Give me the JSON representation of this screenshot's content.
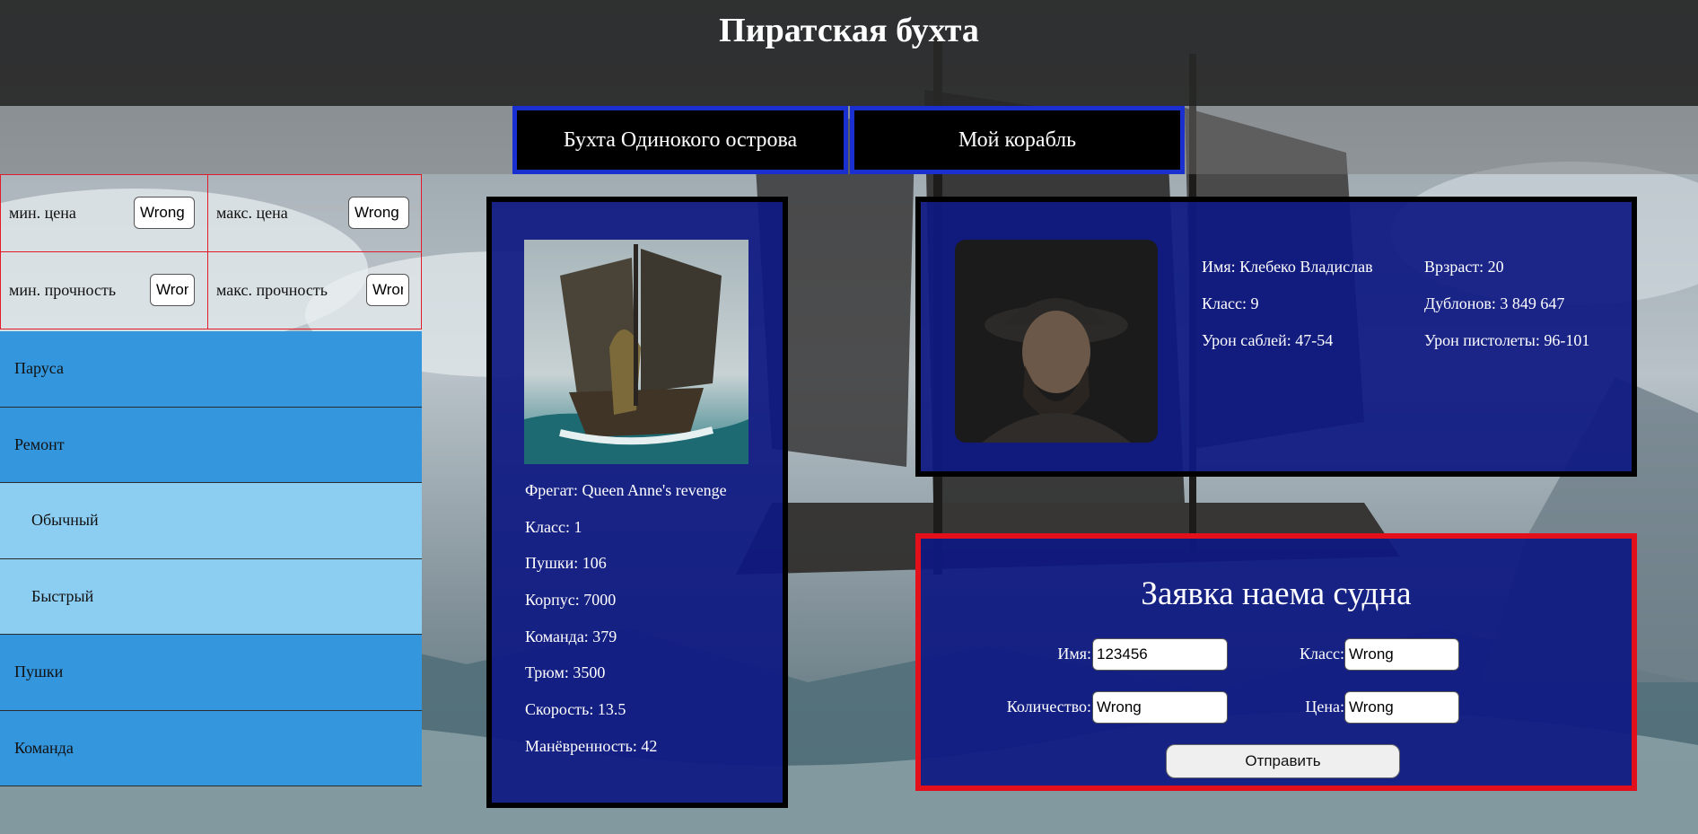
{
  "header": {
    "title": "Пиратская бухта"
  },
  "nav": {
    "tabs": [
      {
        "label": "Бухта Одинокого острова"
      },
      {
        "label": "Мой корабль"
      }
    ]
  },
  "filters": {
    "min_price": {
      "label": "мин. цена",
      "value": "Wrong"
    },
    "max_price": {
      "label": "макс. цена",
      "value": "Wrong"
    },
    "min_durability": {
      "label": "мин. прочность",
      "value": "Wrong"
    },
    "max_durability": {
      "label": "макс. прочность",
      "value": "Wrong"
    }
  },
  "menu": {
    "items": [
      {
        "label": "Паруса"
      },
      {
        "label": "Ремонт"
      },
      {
        "label": "Обычный"
      },
      {
        "label": "Быстрый"
      },
      {
        "label": "Пушки"
      },
      {
        "label": "Команда"
      }
    ]
  },
  "ship": {
    "name": "Фрегат: Queen Anne's revenge",
    "class": "Класс: 1",
    "cannons": "Пушки: 106",
    "hull": "Корпус: 7000",
    "crew": "Команда: 379",
    "hold": "Трюм: 3500",
    "speed": "Скорость: 13.5",
    "maneuver": "Манёвренность: 42"
  },
  "captain": {
    "name": "Имя: Клебеко Владислав",
    "age": "Врзраст: 20",
    "class": "Класс: 9",
    "doubloons": "Дублонов: 3 849 647",
    "saber_damage": "Урон саблей: 47-54",
    "pistol_damage": "Урон пистолеты: 96-101"
  },
  "form": {
    "title": "Заявка наема судна",
    "name_label": "Имя:",
    "name_value": "123456",
    "class_label": "Класс:",
    "class_value": "Wrong",
    "qty_label": "Количество:",
    "qty_value": "Wrong",
    "price_label": "Цена:",
    "price_value": "Wrong",
    "submit_label": "Отправить"
  },
  "colors": {
    "header_bg": "#282828",
    "tab_border": "#1a2fd0",
    "filter_border": "#e01c2a",
    "menu_main": "#3496dd",
    "menu_sub": "#8ccdf2",
    "panel_bg": "#0e1982",
    "form_border": "#e3101c"
  }
}
